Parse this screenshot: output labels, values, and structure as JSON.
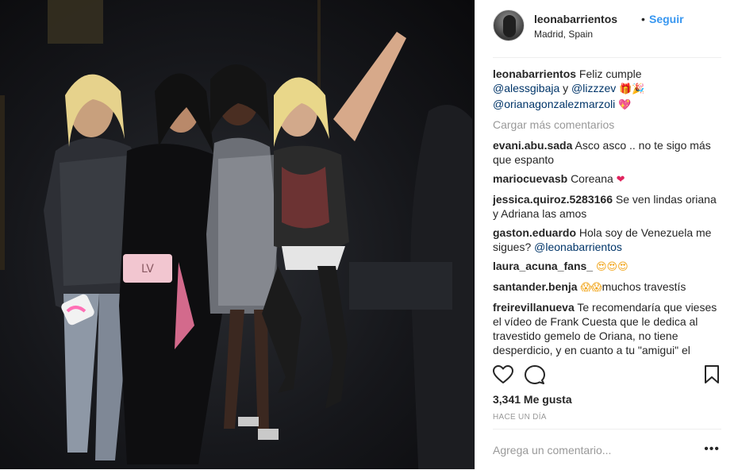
{
  "post": {
    "username": "leonabarrientos",
    "separator": "•",
    "follow_label": "Seguir",
    "location": "Madrid, Spain"
  },
  "caption": {
    "username": "leonabarrientos",
    "text": "Feliz cumple",
    "mention1": "@alessgibaja",
    "conjunction": "y",
    "mention2": "@lizzzev",
    "mention3": "@orianagonzalezmarzoli",
    "emoji_gift": "🎁🎉",
    "emoji_heart": "💖"
  },
  "load_more_label": "Cargar más comentarios",
  "comments": [
    {
      "user": "evani.abu.sada",
      "text": "Asco asco .. no te sigo más que espanto"
    },
    {
      "user": "mariocuevasb",
      "text": "Coreana",
      "emoji": "❤"
    },
    {
      "user": "jessica.quiroz.5283166",
      "text": "Se ven lindas oriana y Adriana las amos"
    },
    {
      "user": "gaston.eduardo",
      "text": "Hola soy de Venezuela me sigues?",
      "mention": "@leonabarrientos"
    },
    {
      "user": "laura_acuna_fans_",
      "emoji": "😍😍😍"
    },
    {
      "user": "santander.benja",
      "emoji": "😱😱",
      "text": "muchos travestís"
    },
    {
      "user": "freirevillanueva",
      "text": "Te recomendaría que vieses el vídeo de Frank Cuesta que le dedica al travestido gemelo de Oriana, no tiene desperdicio, y en cuanto a tu \"amigui\" el fracaso del programa en el"
    }
  ],
  "likes_label": "3,341 Me gusta",
  "timestamp": "HACE UN DÍA",
  "add_comment_placeholder": "Agrega un comentario...",
  "more_options": "•••",
  "icons": {
    "like": "heart-outline-icon",
    "comment": "comment-bubble-icon",
    "save": "bookmark-icon"
  },
  "colors": {
    "link_blue": "#3897f0",
    "mention_blue": "#003569",
    "muted_gray": "#999999",
    "text": "#262626",
    "divider": "#efefef"
  }
}
